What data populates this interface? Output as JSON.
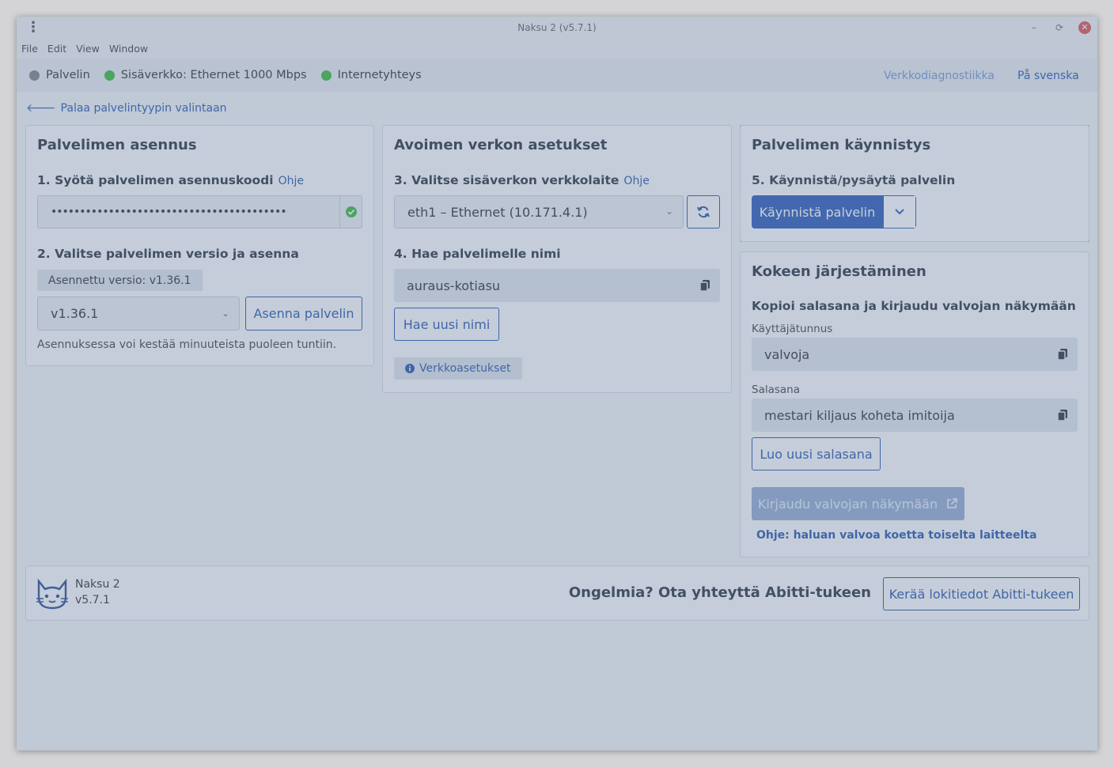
{
  "window": {
    "title": "Naksu 2 (v5.7.1)",
    "minimize_glyph": "–",
    "restore_glyph": "⟳",
    "close_glyph": "✕"
  },
  "menu": [
    "File",
    "Edit",
    "View",
    "Window"
  ],
  "status": {
    "server": "Palvelin",
    "lan": "Sisäverkko: Ethernet 1000 Mbps",
    "internet": "Internetyhteys",
    "diagnostics_link": "Verkkodiagnostiikka",
    "language_link": "På svenska",
    "colors": {
      "server_dot": "#777777",
      "ok_dot": "#2bb52b"
    }
  },
  "back_link": "Palaa palvelintyypin valintaan",
  "install_panel": {
    "title": "Palvelimen asennus",
    "step1_label": "1. Syötä palvelimen asennuskoodi",
    "step1_help": "Ohje",
    "install_code_masked": "•••••••••••••••••••••••••••••••••••••••••",
    "step2_label": "2. Valitse palvelimen versio ja asenna",
    "installed_version": "Asennettu versio: v1.36.1",
    "selected_version": "v1.36.1",
    "install_button": "Asenna palvelin",
    "note": "Asennuksessa voi kestää minuuteista puoleen tuntiin."
  },
  "network_panel": {
    "title": "Avoimen verkon asetukset",
    "step3_label": "3. Valitse sisäverkon verkkolaite",
    "step3_help": "Ohje",
    "selected_device": "eth1 – Ethernet (10.171.4.1)",
    "step4_label": "4. Hae palvelimelle nimi",
    "server_name": "auraus-kotiasu",
    "new_name_button": "Hae uusi nimi",
    "network_settings_tag": "Verkkoasetukset"
  },
  "start_panel": {
    "title": "Palvelimen käynnistys",
    "step5_label": "5. Käynnistä/pysäytä palvelin",
    "start_button": "Käynnistä palvelin"
  },
  "exam_panel": {
    "title": "Kokeen järjestäminen",
    "subtitle": "Kopioi salasana ja kirjaudu valvojan näkymään",
    "username_label": "Käyttäjätunnus",
    "username": "valvoja",
    "password_label": "Salasana",
    "password": "mestari kiljaus koheta imitoija",
    "new_password_button": "Luo uusi salasana",
    "login_button": "Kirjaudu valvojan näkymään",
    "help_link": "Ohje: haluan valvoa koetta toiselta laitteelta"
  },
  "footer": {
    "app_name": "Naksu 2",
    "app_version": "v5.7.1",
    "support_text": "Ongelmia? Ota yhteyttä Abitti-tukeen",
    "logs_button": "Kerää lokitiedot Abitti-tukeen"
  },
  "colors": {
    "accent": "#1a4aa8",
    "primary_button": "#1e4fb3",
    "dim_overlay": "#788caa"
  }
}
